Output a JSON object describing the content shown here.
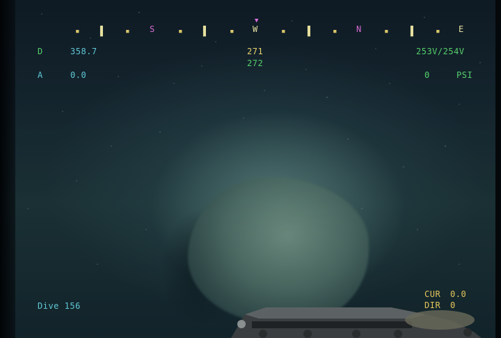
{
  "compass": {
    "letters": {
      "s": "S",
      "w": "W",
      "n": "N",
      "e": "E"
    },
    "heading_major": "271",
    "heading_minor": "272"
  },
  "hud": {
    "depth_label": "D",
    "depth_value": "358.7",
    "altitude_label": "A",
    "altitude_value": "0.0",
    "voltage": "253V/254V",
    "pressure_value": "0",
    "pressure_unit": "PSI",
    "dive": "Dive 156",
    "current_label": "CUR",
    "current_value": "0.0",
    "direction_label": "DIR",
    "direction_value": "0"
  },
  "colors": {
    "hud_cyan": "#5fc7d6",
    "hud_green": "#56d06a",
    "hud_yellow": "#e4c45a",
    "compass_magenta": "#d66ad0"
  }
}
